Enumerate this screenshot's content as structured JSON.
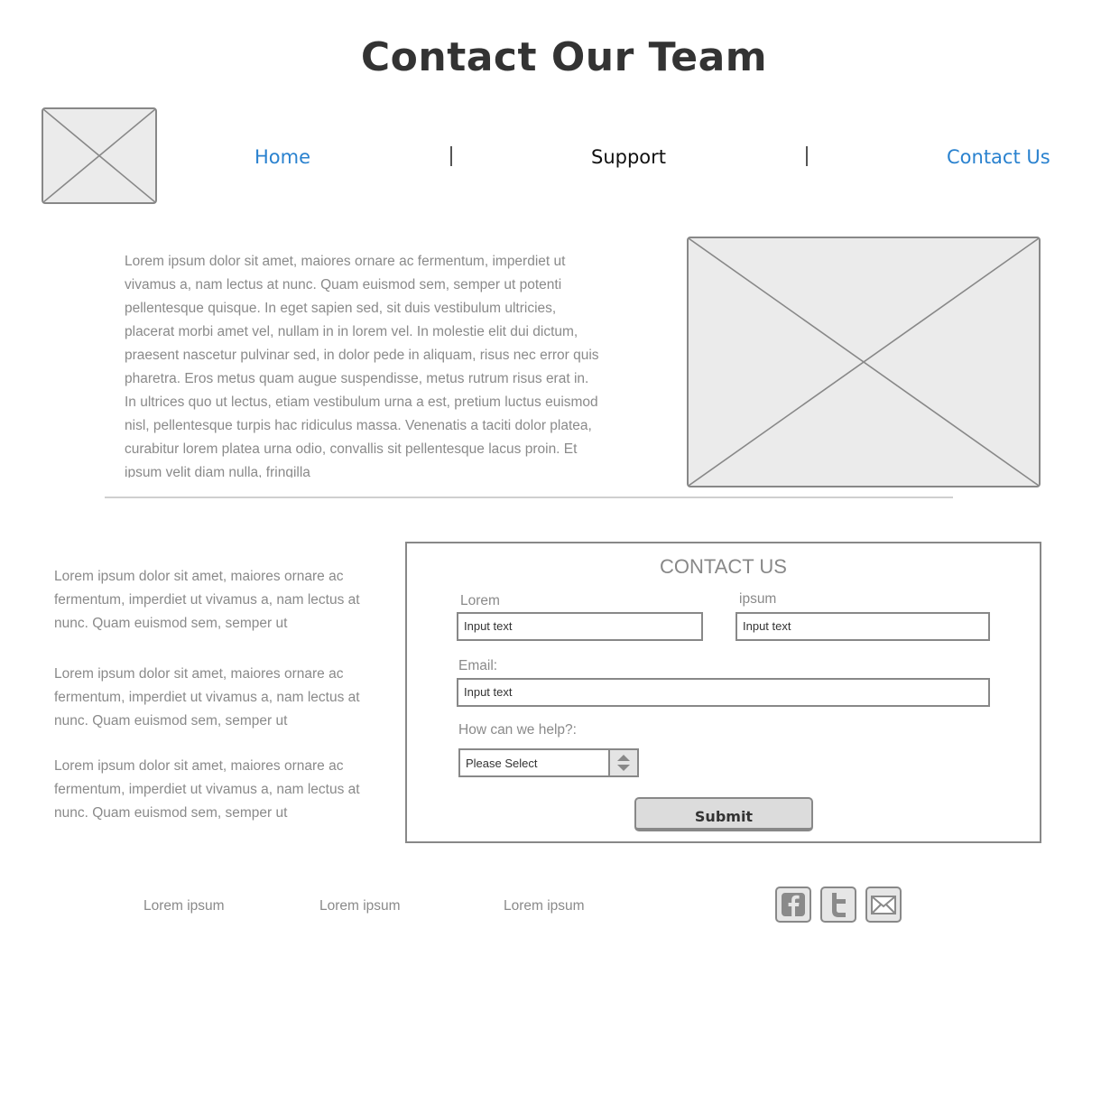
{
  "header": {
    "title": "Contact Our Team"
  },
  "nav": {
    "items": [
      {
        "label": "Home",
        "color": "#2a82cf"
      },
      {
        "label": "Support",
        "color": "#111111"
      },
      {
        "label": "Contact Us",
        "color": "#2a82cf"
      }
    ]
  },
  "intro": {
    "text": "Lorem ipsum dolor sit amet, maiores ornare ac fermentum, imperdiet ut vivamus a, nam lectus at nunc. Quam euismod sem, semper ut potenti pellentesque quisque. In eget sapien sed, sit duis vestibulum ultricies, placerat morbi amet vel, nullam in in lorem vel. In molestie elit dui dictum, praesent nascetur pulvinar sed, in dolor pede in aliquam, risus nec error quis pharetra. Eros metus quam augue suspendisse, metus rutrum risus erat in.  In ultrices quo ut lectus, etiam vestibulum urna a est, pretium luctus euismod nisl, pellentesque turpis hac ridiculus massa. Venenatis a taciti dolor platea, curabitur lorem platea urna odio, convallis sit pellentesque lacus proin. Et ipsum velit diam nulla, fringilla"
  },
  "side_paragraphs": [
    "Lorem ipsum dolor sit amet, maiores ornare ac fermentum, imperdiet ut vivamus a, nam lectus at nunc. Quam euismod sem, semper ut",
    "Lorem ipsum dolor sit amet, maiores ornare ac fermentum, imperdiet ut vivamus a, nam lectus at nunc. Quam euismod sem, semper ut",
    "Lorem ipsum dolor sit amet, maiores ornare ac fermentum, imperdiet ut vivamus a, nam lectus at nunc. Quam euismod sem, semper ut"
  ],
  "form": {
    "title": "CONTACT US",
    "field1_label": "Lorem",
    "field1_value": "Input text",
    "field2_label": "ipsum",
    "field2_value": "Input text",
    "email_label": "Email:",
    "email_value": "Input text",
    "help_label": "How can we help?:",
    "help_selected": "Please Select",
    "submit_label": "Submit"
  },
  "footer": {
    "links": [
      "Lorem ipsum",
      "Lorem ipsum",
      "Lorem ipsum"
    ],
    "social_icons": [
      "facebook-icon",
      "twitter-icon",
      "email-icon"
    ]
  }
}
